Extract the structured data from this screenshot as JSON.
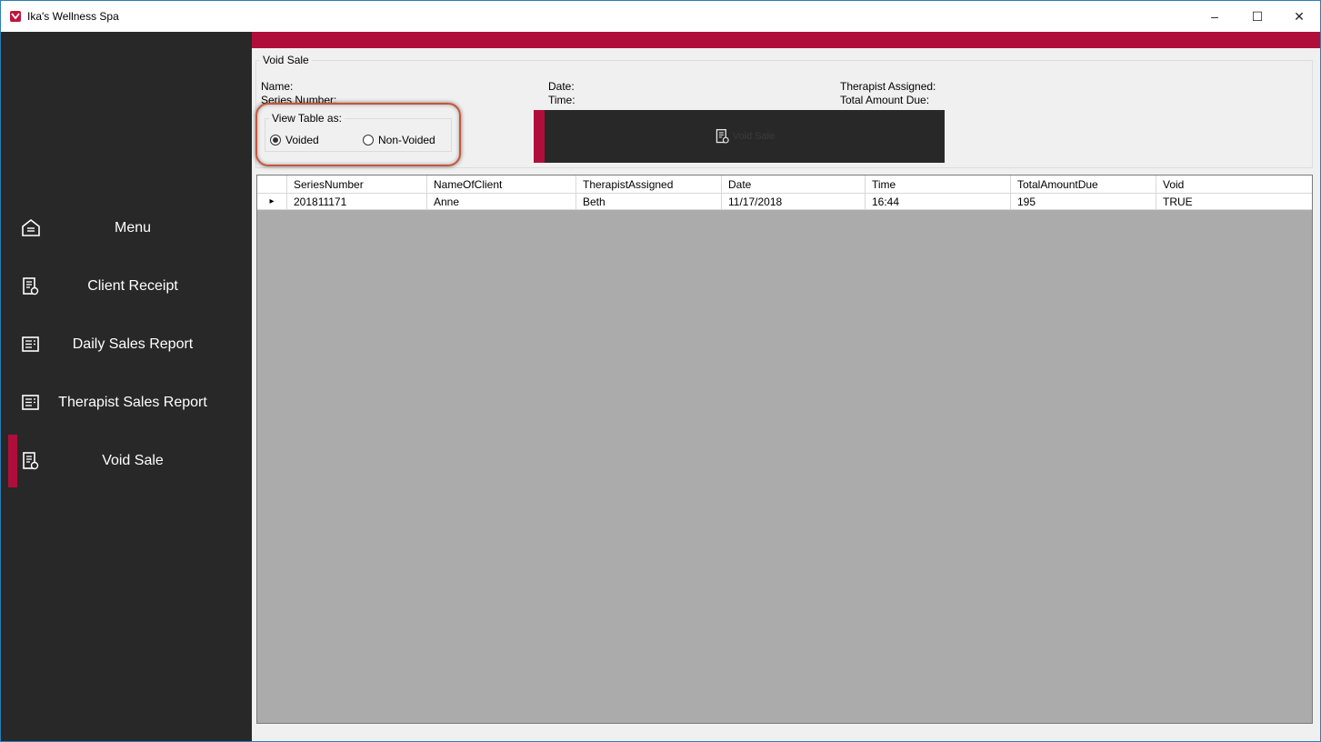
{
  "window": {
    "title": "Ika's Wellness Spa",
    "minimize": "–",
    "maximize": "☐",
    "close": "✕",
    "brand_color": "#b00e3a"
  },
  "sidebar": {
    "items": [
      {
        "label": "Menu",
        "icon": "menu-icon",
        "active": false
      },
      {
        "label": "Client Receipt",
        "icon": "receipt-icon",
        "active": false
      },
      {
        "label": "Daily Sales Report",
        "icon": "report-icon",
        "active": false
      },
      {
        "label": "Therapist Sales Report",
        "icon": "report-icon",
        "active": false
      },
      {
        "label": "Void Sale",
        "icon": "receipt-icon",
        "active": true
      }
    ]
  },
  "void_sale": {
    "legend": "Void Sale",
    "name_label": "Name:",
    "series_label": "Series Number:",
    "date_label": "Date:",
    "time_label": "Time:",
    "therapist_label": "Therapist Assigned:",
    "total_label": "Total Amount Due:",
    "view_table_legend": "View Table as:",
    "radio_voided": "Voided",
    "radio_non_voided": "Non-Voided",
    "selected_view": "Voided",
    "button_label": "Void Sale"
  },
  "grid": {
    "columns": [
      "SeriesNumber",
      "NameOfClient",
      "TherapistAssigned",
      "Date",
      "Time",
      "TotalAmountDue",
      "Void"
    ],
    "rows": [
      [
        "201811171",
        "Anne",
        "Beth",
        "11/17/2018",
        "16:44",
        "195",
        "TRUE"
      ]
    ],
    "current_row_marker": "▸"
  }
}
